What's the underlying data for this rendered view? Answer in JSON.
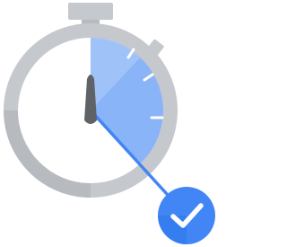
{
  "illustration": {
    "subject": "stopwatch-with-checkmark",
    "icons": [
      "stopwatch-icon",
      "checkmark-icon"
    ],
    "elapsed_fraction": 0.38,
    "colors": {
      "ring": "#c5c8cc",
      "ring_shadow": "#b0b4b9",
      "dial_face": "#ffffff",
      "elapsed_fill": "#8ab4f8",
      "elapsed_fill_light": "#aecbfa",
      "hand_line": "#4285f4",
      "hour_hand": "#5f6368",
      "tick_marks": "#ffffff",
      "badge": "#4285f4",
      "badge_dark": "#1a73e8",
      "check": "#ffffff"
    }
  }
}
